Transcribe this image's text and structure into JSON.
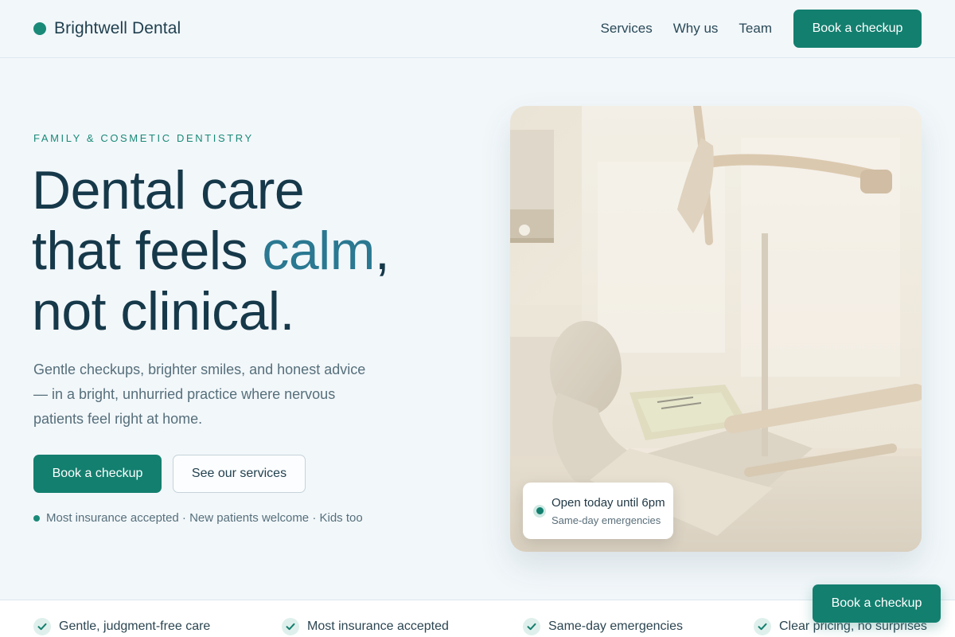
{
  "brand": {
    "name": "Brightwell Dental",
    "color": "#1a8a78"
  },
  "nav": {
    "links": [
      "Services",
      "Why us",
      "Team"
    ],
    "cta": "Book a checkup"
  },
  "hero": {
    "eyebrow": "FAMILY & COSMETIC DENTISTRY",
    "headline": {
      "line1": "Dental care",
      "line2_pre": "that feels ",
      "line2_accent": "calm",
      "line2_post": ",",
      "line3": "not clinical."
    },
    "lede": "Gentle checkups, brighter smiles, and honest advice — in a bright, unhurried practice where nervous patients feel right at home.",
    "primary_cta": "Book a checkup",
    "secondary_cta": "See our services",
    "trust_line": "Most insurance accepted · New patients welcome · Kids too",
    "image_icon": "dental-clinic-photo",
    "status_card": {
      "title": "Open today until 6pm",
      "subtitle": "Same-day emergencies"
    }
  },
  "features": [
    "Gentle, judgment-free care",
    "Most insurance accepted",
    "Same-day emergencies",
    "Clear pricing, no surprises"
  ],
  "floating_cta": "Book a checkup",
  "colors": {
    "accent": "#137f6f",
    "accent_text": "#2a7891",
    "heading": "#16394a",
    "background": "#f2f7fa"
  }
}
